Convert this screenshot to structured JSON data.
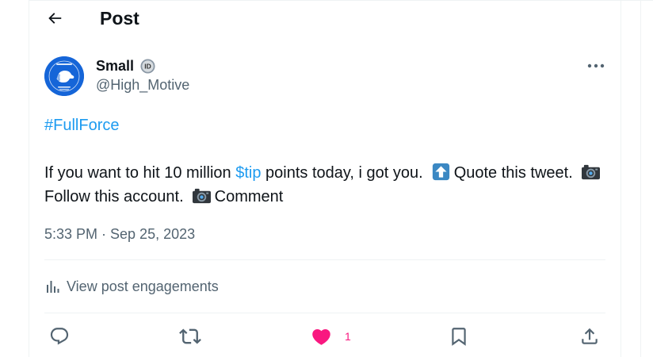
{
  "header": {
    "title": "Post"
  },
  "post": {
    "author": {
      "display_name": "Small",
      "handle": "@High_Motive",
      "badge": "ID"
    },
    "hashtag": "#FullForce",
    "text": {
      "line1_part1": "If you want to hit 10 million ",
      "cashtag": "$tip",
      "line1_part2": " points today, i got you.",
      "quote": "Quote this tweet.",
      "follow": "Follow this account.",
      "comment": "Comment"
    },
    "timestamp": "5:33 PM · Sep 25, 2023",
    "engagements_label": "View post engagements",
    "like_count": "1",
    "liked": true
  },
  "colors": {
    "accent": "#1d9bf0",
    "like": "#f91880",
    "muted": "#536471"
  }
}
